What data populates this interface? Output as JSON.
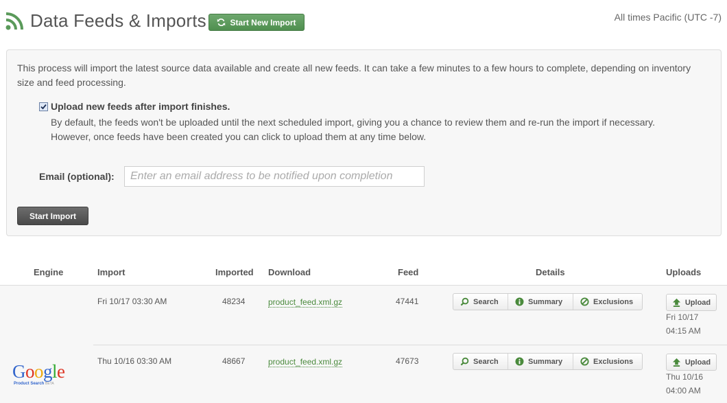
{
  "header": {
    "title": "Data Feeds & Imports",
    "new_import_label": "Start New Import",
    "timezone_note": "All times Pacific (UTC -7)"
  },
  "import_panel": {
    "intro": "This process will import the latest source data available and create all new feeds. It can take a few minutes to a few hours to complete, depending on inventory size and feed processing.",
    "upload_checkbox_checked": true,
    "upload_label": "Upload new feeds after import finishes.",
    "help_line_1": "By default, the feeds won't be uploaded until the next scheduled import, giving you a chance to review them and re-run the import if necessary.",
    "help_line_2": "However, once feeds have been created you can click to upload them at any time below.",
    "email_label": "Email (optional):",
    "email_value": "",
    "email_placeholder": "Enter an email address to be notified upon completion",
    "start_button": "Start Import"
  },
  "table": {
    "columns": {
      "engine": "Engine",
      "import": "Import",
      "imported": "Imported",
      "download": "Download",
      "feed": "Feed",
      "details": "Details",
      "uploads": "Uploads"
    },
    "engine": {
      "logo_text": "Google",
      "logo_subtext": "Product Search",
      "logo_badge": "BETA"
    },
    "detail_buttons": {
      "search": "Search",
      "summary": "Summary",
      "exclusions": "Exclusions",
      "upload": "Upload"
    },
    "rows": [
      {
        "import": "Fri 10/17 03:30 AM",
        "imported": "48234",
        "download": "product_feed.xml.gz",
        "feed": "47441",
        "upload_date": "Fri 10/17",
        "upload_time": "04:15 AM"
      },
      {
        "import": "Thu 10/16 03:30 AM",
        "imported": "48667",
        "download": "product_feed.xml.gz",
        "feed": "47673",
        "upload_date": "Thu 10/16",
        "upload_time": "04:00 AM"
      }
    ]
  },
  "colors": {
    "accent_green": "#5a9a5a",
    "link_green": "#4a8a3c",
    "panel_bg": "#f7f7f7",
    "dark_button": "#555555"
  }
}
